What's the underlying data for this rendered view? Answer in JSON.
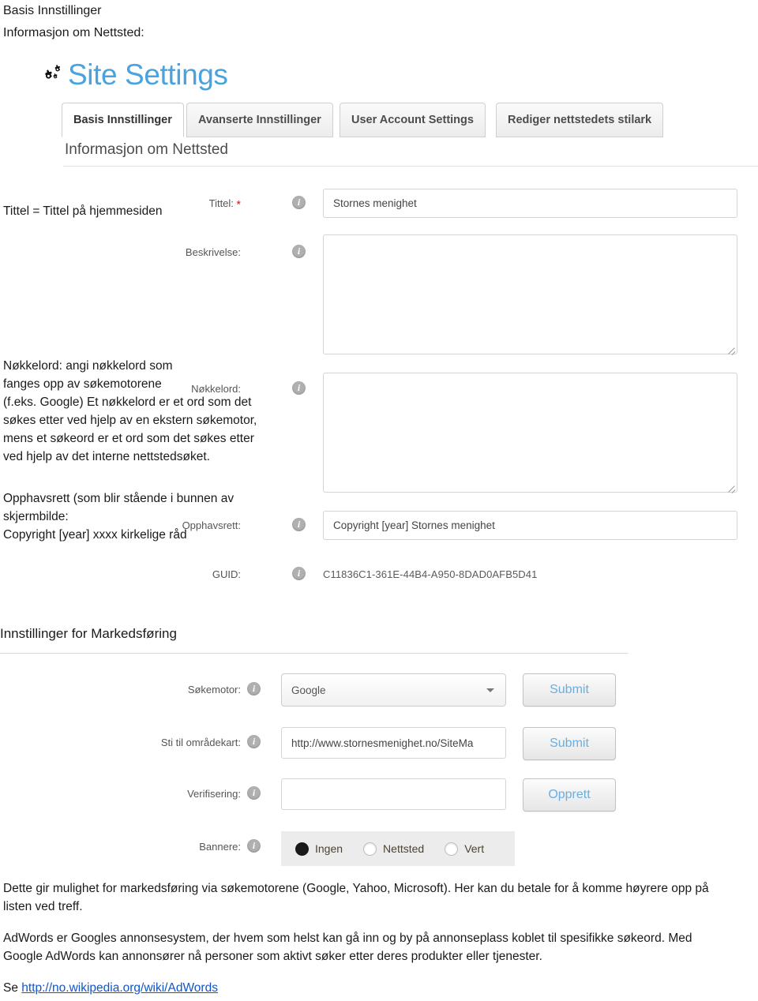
{
  "document": {
    "title_line_1": "Basis Innstillinger",
    "title_line_2": "Informasjon om Nettsted:",
    "note_tittel": "Tittel = Tittel på hjemmesiden",
    "note_keywords": "Nøkkelord: angi nøkkelord som\nfanges opp av søkemotorene\n(f.eks. Google) Et nøkkelord er et ord som det\nsøkes etter ved hjelp av en ekstern søkemotor,\nmens et søkeord er et ord som det søkes etter\nved hjelp av det interne nettstedsøket.",
    "note_copyright": "Opphavsrett (som blir stående i bunnen av\nskjermbilde:\nCopyright [year] xxxx kirkelige råd",
    "section_marketing": "Innstillinger for Markedsføring",
    "paragraph_1": "Dette gir mulighet for markedsføring via søkemotorene (Google, Yahoo, Microsoft). Her kan du betale for å komme høyrere opp på listen ved treff.",
    "paragraph_2": "AdWords er Googles annonsesystem, der hvem som helst kan gå inn og by på annonseplass koblet til spesifikke søkeord. Med Google AdWords kan annonsører nå personer som aktivt søker etter deres produkter eller tjenester.",
    "paragraph_3_prefix": "Se ",
    "paragraph_3_link": "http://no.wikipedia.org/wiki/AdWords"
  },
  "app": {
    "brand_title": "Site Settings",
    "brand_icon": "gears-icon",
    "accent_color": "#4aa3df",
    "tabs": [
      {
        "label": "Basis Innstillinger",
        "active": true
      },
      {
        "label": "Avanserte Innstillinger",
        "active": false
      },
      {
        "label": "User Account Settings",
        "active": false
      },
      {
        "label": "Rediger nettstedets stilark",
        "active": false
      }
    ],
    "panel_title": "Informasjon om Nettsted",
    "info_icon_glyph": "i",
    "fields": {
      "tittel": {
        "label": "Tittel:",
        "required_marker": "*",
        "value": "Stornes menighet"
      },
      "beskrivelse": {
        "label": "Beskrivelse:",
        "value": ""
      },
      "nokkelord": {
        "label": "Nøkkelord:",
        "value": ""
      },
      "opphavsrett": {
        "label": "Opphavsrett:",
        "value": "Copyright [year] Stornes menighet"
      },
      "guid": {
        "label": "GUID:",
        "value": "C11836C1-361E-44B4-A950-8DAD0AFB5D41"
      }
    },
    "marketing": {
      "sokemotor": {
        "label": "Søkemotor:",
        "selected": "Google",
        "options": [
          "Google"
        ],
        "button": "Submit"
      },
      "omradekart": {
        "label": "Sti til områdekart:",
        "value": "http://www.stornesmenighet.no/SiteMa",
        "button": "Submit"
      },
      "verifisering": {
        "label": "Verifisering:",
        "value": "",
        "button": "Opprett"
      },
      "bannere": {
        "label": "Bannere:",
        "options": [
          {
            "label": "Ingen",
            "checked": true
          },
          {
            "label": "Nettsted",
            "checked": false
          },
          {
            "label": "Vert",
            "checked": false
          }
        ]
      }
    }
  }
}
